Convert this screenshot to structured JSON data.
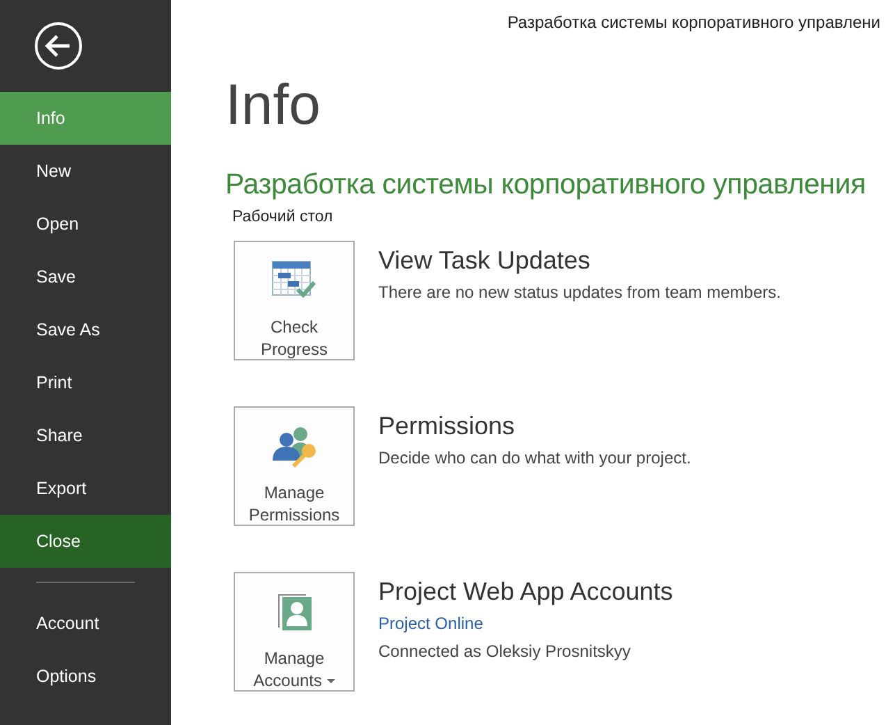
{
  "window": {
    "title": "Разработка системы корпоративного управлени"
  },
  "nav": {
    "items": [
      {
        "label": "Info",
        "selected": true,
        "hovered": false
      },
      {
        "label": "New",
        "selected": false,
        "hovered": false
      },
      {
        "label": "Open",
        "selected": false,
        "hovered": false
      },
      {
        "label": "Save",
        "selected": false,
        "hovered": false
      },
      {
        "label": "Save As",
        "selected": false,
        "hovered": false
      },
      {
        "label": "Print",
        "selected": false,
        "hovered": false
      },
      {
        "label": "Share",
        "selected": false,
        "hovered": false
      },
      {
        "label": "Export",
        "selected": false,
        "hovered": false
      },
      {
        "label": "Close",
        "selected": false,
        "hovered": true
      }
    ],
    "footer_items": [
      {
        "label": "Account",
        "selected": false,
        "hovered": false
      },
      {
        "label": "Options",
        "selected": false,
        "hovered": false
      }
    ]
  },
  "page": {
    "heading": "Info",
    "project_name": "Разработка системы корпоративного управления",
    "location": "Рабочий стол"
  },
  "sections": [
    {
      "kind": "progress",
      "button": "Check Progress",
      "dropdown": false,
      "title": "View Task Updates",
      "lines": [
        {
          "kind": "text",
          "text": "There are no new status updates from team members."
        }
      ]
    },
    {
      "kind": "permissions",
      "button": "Manage Permissions",
      "dropdown": false,
      "title": "Permissions",
      "lines": [
        {
          "kind": "text",
          "text": "Decide who can do what with your project."
        }
      ]
    },
    {
      "kind": "accounts",
      "button": "Manage Accounts",
      "dropdown": true,
      "title": "Project Web App Accounts",
      "lines": [
        {
          "kind": "link",
          "text": "Project Online"
        },
        {
          "kind": "text",
          "text": "Connected as Oleksiy Prosnitskyy"
        }
      ]
    }
  ]
}
